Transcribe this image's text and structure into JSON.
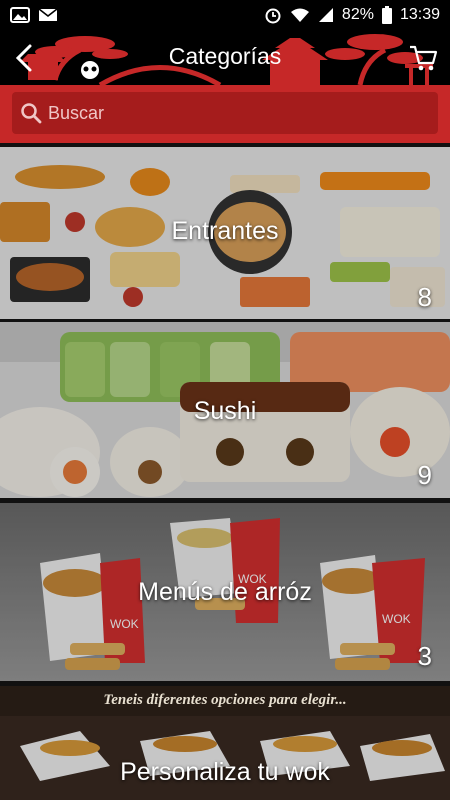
{
  "status_bar": {
    "battery": "82%",
    "time": "13:39"
  },
  "header": {
    "title": "Categorías"
  },
  "search": {
    "placeholder": "Buscar"
  },
  "categories": [
    {
      "name": "Entrantes",
      "count": "8"
    },
    {
      "name": "Sushi",
      "count": "9"
    },
    {
      "name": "Menús de arróz",
      "count": "3"
    },
    {
      "name": "Personaliza tu wok",
      "count": ""
    }
  ],
  "banner_text": "Teneis diferentes opciones para elegir...",
  "colors": {
    "brand_red": "#c62828",
    "search_bg": "#a51c1c",
    "app_bar": "#000000"
  }
}
